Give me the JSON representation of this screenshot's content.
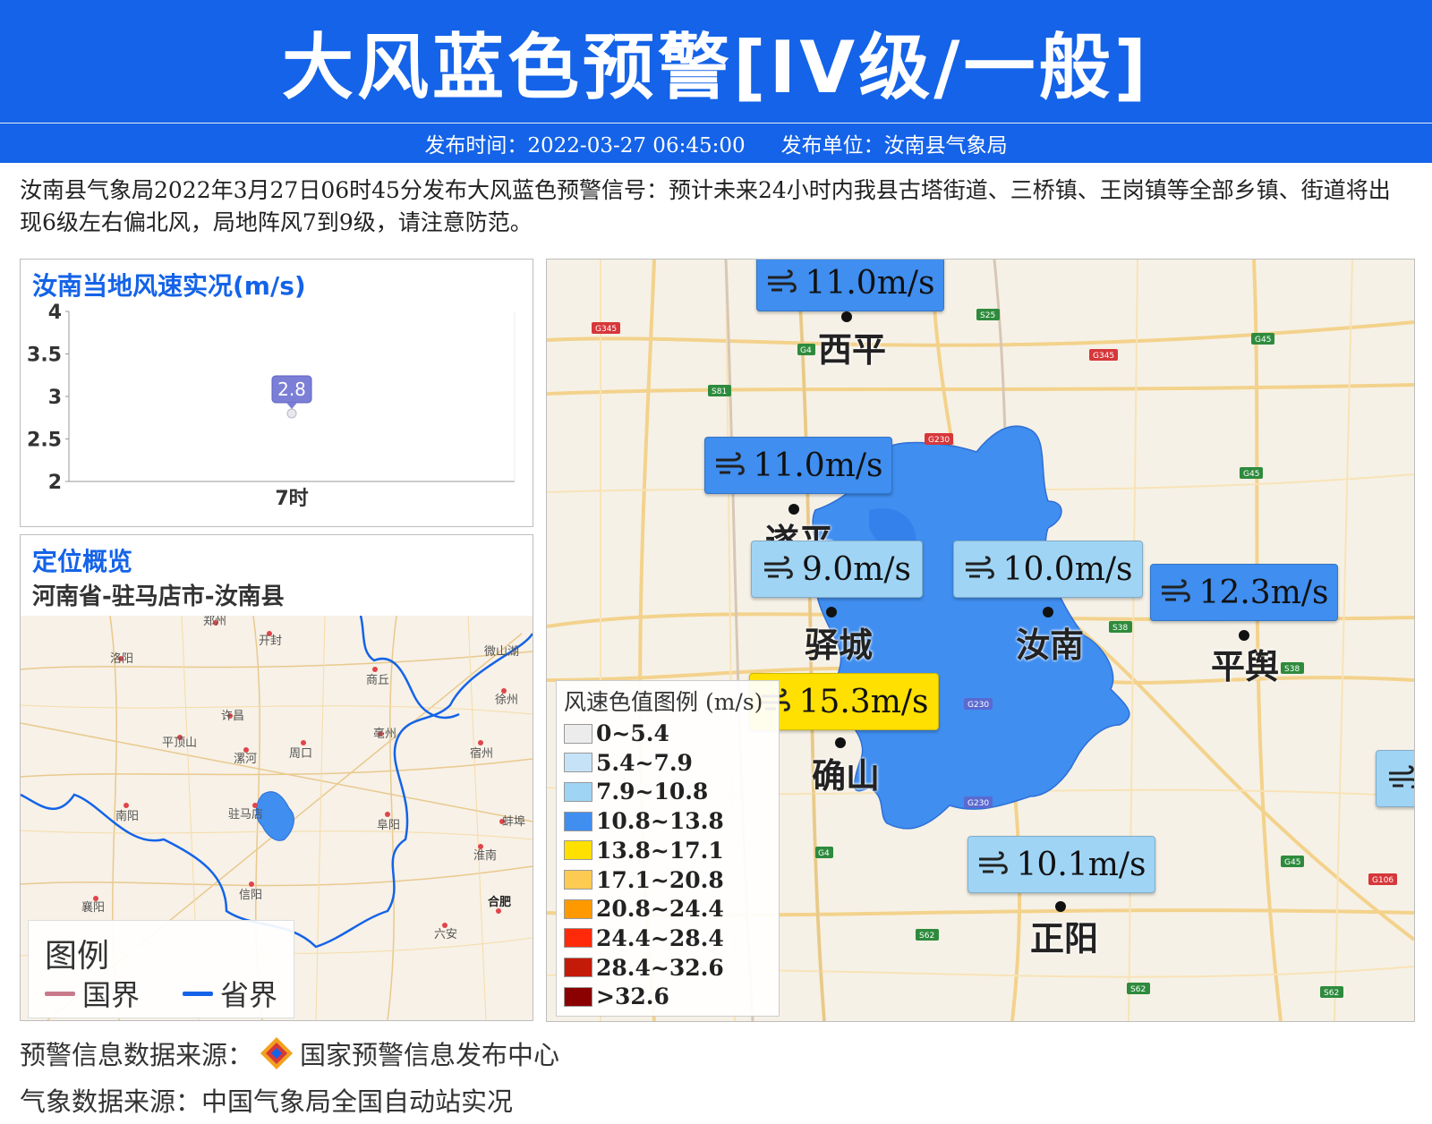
{
  "header": {
    "title": "大风蓝色预警[IV级/一般]",
    "publish_time": "发布时间：2022-03-27 06:45:00",
    "publish_unit": "发布单位：汝南县气象局"
  },
  "description": "汝南县气象局2022年3月27日06时45分发布大风蓝色预警信号：预计未来24小时内我县古塔街道、三桥镇、王岗镇等全部乡镇、街道将出现6级左右偏北风，局地阵风7到9级，请注意防范。",
  "wind_panel": {
    "title": "汝南当地风速实况(m/s)"
  },
  "chart_data": {
    "type": "scatter",
    "title": "汝南当地风速实况(m/s)",
    "categories": [
      "7时"
    ],
    "values": [
      2.8
    ],
    "data_labels": [
      "2.8"
    ],
    "yticks": [
      "4",
      "3.5",
      "3",
      "2.5",
      "2"
    ],
    "ylim": [
      2,
      4
    ],
    "grid": false,
    "point_color": "#7b7fd6"
  },
  "location_panel": {
    "title": "定位概览",
    "path": "河南省-驻马店市-汝南县",
    "legend_title": "图例",
    "legend_items": [
      {
        "label": "国界",
        "color": "#c97a8a"
      },
      {
        "label": "省界",
        "color": "#1463e8"
      }
    ],
    "cities": [
      "郑州",
      "开封",
      "洛阳",
      "商丘",
      "微山湖",
      "徐州",
      "许昌",
      "平顶山",
      "亳州",
      "漯河",
      "周口",
      "宿州",
      "南阳",
      "驻马店",
      "阜阳",
      "蚌埠",
      "淮南",
      "信阳",
      "合肥",
      "襄阳",
      "六安"
    ]
  },
  "wind_map": {
    "stations": [
      {
        "value": "11.0m/s",
        "city": "西平",
        "color": "#3f8ef0"
      },
      {
        "value": "11.0m/s",
        "city": "遂平",
        "color": "#3f8ef0"
      },
      {
        "value": "9.0m/s",
        "city": "驿城",
        "color": "#9fd4f5"
      },
      {
        "value": "10.0m/s",
        "city": "汝南",
        "color": "#9fd4f5"
      },
      {
        "value": "12.3m/s",
        "city": "平舆",
        "color": "#3f8ef0"
      },
      {
        "value": "15.3m/s",
        "city": "确山",
        "color": "#ffe000"
      },
      {
        "value": "10.1m/s",
        "city": "正阳",
        "color": "#9fd4f5"
      }
    ],
    "roads": [
      "G345",
      "S25",
      "G45",
      "G4",
      "S81",
      "G345",
      "G230",
      "G45",
      "S38",
      "S38",
      "G230",
      "G230",
      "G4",
      "G45",
      "G106",
      "S62",
      "S62",
      "S62"
    ],
    "legend_title": "风速色值图例 (m/s)",
    "legend": [
      {
        "range": "0~5.4",
        "color": "#ececec"
      },
      {
        "range": "5.4~7.9",
        "color": "#c6e2f7"
      },
      {
        "range": "7.9~10.8",
        "color": "#9fd4f5"
      },
      {
        "range": "10.8~13.8",
        "color": "#3f8ef0"
      },
      {
        "range": "13.8~17.1",
        "color": "#ffe000"
      },
      {
        "range": "17.1~20.8",
        "color": "#fecb52"
      },
      {
        "range": "20.8~24.4",
        "color": "#ff9900"
      },
      {
        "range": "24.4~28.4",
        "color": "#ff2a0a"
      },
      {
        "range": "28.4~32.6",
        "color": "#c41a0a"
      },
      {
        "range": ">32.6",
        "color": "#8b0000"
      }
    ]
  },
  "footer": {
    "warning_source": "预警信息数据来源：",
    "warning_source_name": "国家预警信息发布中心",
    "weather_source": "气象数据来源：中国气象局全国自动站实况"
  }
}
